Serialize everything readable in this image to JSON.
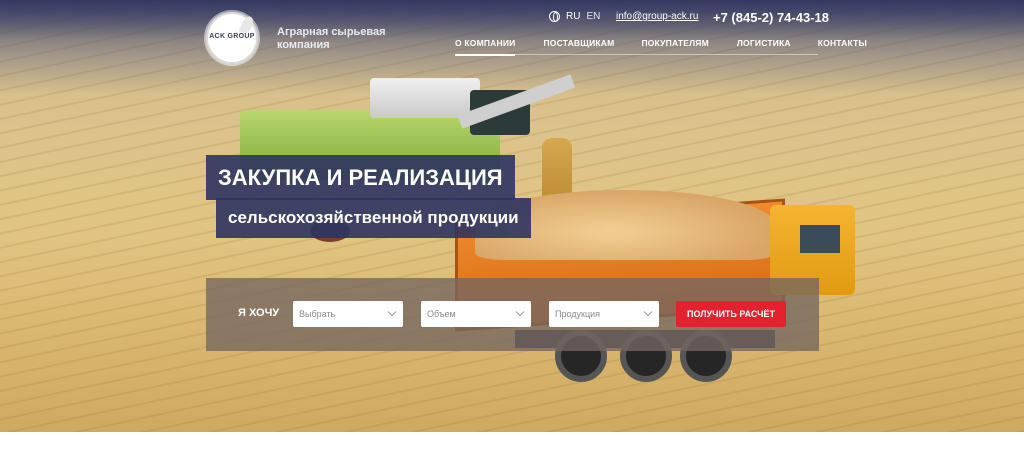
{
  "brand": {
    "logo_text": "ACK GROUP",
    "tagline_line1": "Аграрная сырьевая",
    "tagline_line2": "компания"
  },
  "header": {
    "languages": [
      "RU",
      "EN"
    ],
    "active_language": "RU",
    "email": "info@group-ack.ru",
    "phone": "+7 (845-2) 74-43-18"
  },
  "nav": {
    "items": [
      {
        "label": "О КОМПАНИИ",
        "active": true
      },
      {
        "label": "ПОСТАВЩИКАМ",
        "active": false
      },
      {
        "label": "ПОКУПАТЕЛЯМ",
        "active": false
      },
      {
        "label": "ЛОГИСТИКА",
        "active": false
      },
      {
        "label": "КОНТАКТЫ",
        "active": false
      }
    ]
  },
  "hero": {
    "title_line1": "ЗАКУПКА И РЕАЛИЗАЦИЯ",
    "title_line2": "сельскохозяйственной продукции"
  },
  "search": {
    "label": "Я ХОЧУ",
    "selects": [
      {
        "value": "Выбрать"
      },
      {
        "value": "Объем"
      },
      {
        "value": "Продукция"
      }
    ],
    "button_label": "ПОЛУЧИТЬ РАСЧЁТ"
  },
  "colors": {
    "primary_dark": "#2d3460",
    "accent_red": "#e2232f",
    "panel": "#746761"
  },
  "icons": {
    "globe": "globe-icon",
    "chevron": "chevron-down-icon"
  }
}
